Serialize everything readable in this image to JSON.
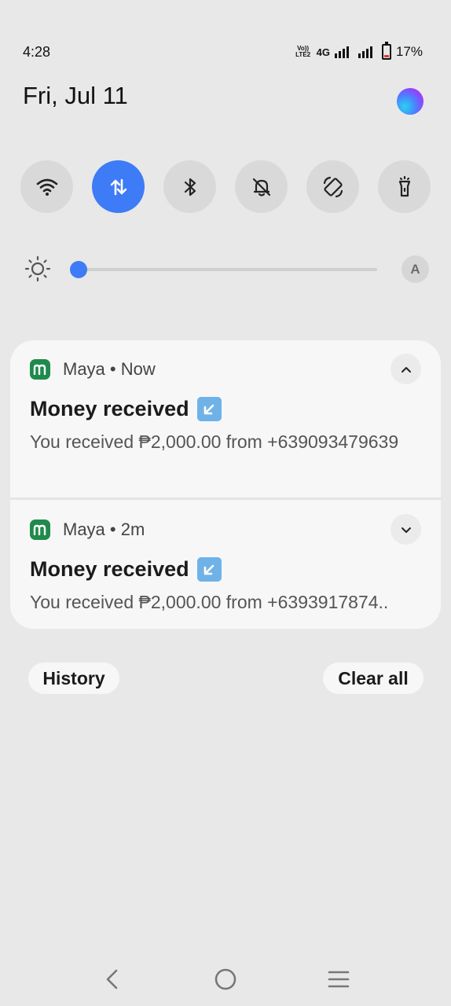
{
  "status_bar": {
    "time": "4:28",
    "volte_line1": "Vo))",
    "volte_line2": "LTE2",
    "network": "4G",
    "battery_text": "17%",
    "battery_level": 0.17
  },
  "header": {
    "date": "Fri, Jul 11",
    "assistant_icon": "assistant-orb-icon"
  },
  "quick_tiles": [
    {
      "name": "wifi",
      "icon": "wifi-icon",
      "active": false
    },
    {
      "name": "mobile-data",
      "icon": "data-arrows-icon",
      "active": true
    },
    {
      "name": "bluetooth",
      "icon": "bluetooth-icon",
      "active": false
    },
    {
      "name": "do-not-disturb",
      "icon": "bell-off-icon",
      "active": false
    },
    {
      "name": "auto-rotate",
      "icon": "rotate-icon",
      "active": false
    },
    {
      "name": "flashlight",
      "icon": "flashlight-icon",
      "active": false
    }
  ],
  "brightness": {
    "level": 0.02,
    "auto_label": "A"
  },
  "notifications": [
    {
      "app": "Maya",
      "time": "Now",
      "meta": "Maya • Now",
      "title": "Money received",
      "body": "You received ₱2,000.00 from +639093479639",
      "expanded": true
    },
    {
      "app": "Maya",
      "time": "2m",
      "meta": "Maya • 2m",
      "title": "Money received",
      "body": "You received ₱2,000.00 from +6393917874..",
      "expanded": false
    }
  ],
  "actions": {
    "history_label": "History",
    "clear_all_label": "Clear all"
  },
  "navigation": {
    "back_icon": "back-icon",
    "home_icon": "home-icon",
    "recents_icon": "recents-icon"
  },
  "colors": {
    "accent": "#3d7bf7",
    "maya_green": "#1f8a4c",
    "background": "#e8e8e8",
    "card": "#f7f7f7"
  }
}
